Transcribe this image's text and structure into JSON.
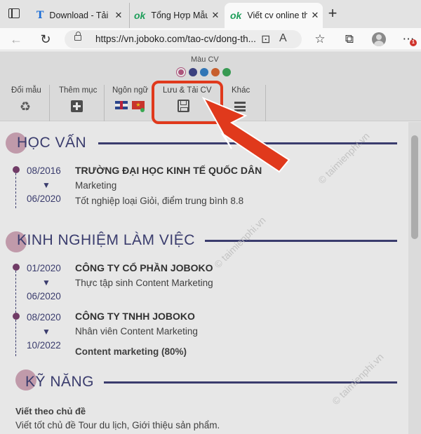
{
  "browser": {
    "tabs": [
      {
        "favicon": "T",
        "title": "Download - Tải",
        "close": "✕"
      },
      {
        "favicon": "ok",
        "title": "Tổng Hợp Mẫu",
        "close": "✕"
      },
      {
        "favicon": "ok",
        "title": "Viết cv online th",
        "close": "✕"
      }
    ],
    "url": "https://vn.joboko.com/tao-cv/dong-th...",
    "notification_count": "1",
    "icons": [
      "tab-actions-icon",
      "back-icon",
      "refresh-icon",
      "lock-icon",
      "page-icon",
      "read-aloud-icon",
      "favorites-icon",
      "collections-icon",
      "profile-icon",
      "menu-dots-icon"
    ]
  },
  "toolbar": {
    "color_label": "Màu CV",
    "colors": [
      "#b84d7d",
      "#2e3580",
      "#2176c4",
      "#d85a1e",
      "#2aa14b"
    ],
    "tools": [
      {
        "label": "Đổi mẫu",
        "icon": "recycle-icon"
      },
      {
        "label": "Thêm mục",
        "icon": "plus-square-icon"
      },
      {
        "label": "Ngôn ngữ",
        "icon": "flag-icon"
      },
      {
        "label": "Lưu & Tải CV",
        "icon": "save-icon"
      },
      {
        "label": "Khác",
        "icon": "menu-icon"
      }
    ]
  },
  "education": {
    "title": "HỌC VẤN",
    "entries": [
      {
        "start": "08/2016",
        "end": "06/2020",
        "school": "TRƯỜNG ĐẠI HỌC KINH TẾ QUỐC DÂN",
        "major": "Marketing",
        "note": "Tốt nghiệp loại Giỏi, điểm trung bình 8.8"
      }
    ]
  },
  "experience": {
    "title": "KINH NGHIỆM LÀM VIỆC",
    "entries": [
      {
        "start": "01/2020",
        "end": "06/2020",
        "company": "CÔNG TY CỔ PHẦN JOBOKO",
        "role": "Thực tập sinh Content Marketing"
      },
      {
        "start": "08/2020",
        "end": "10/2022",
        "company": "CÔNG TY TNHH JOBOKO",
        "role": "Nhân viên Content Marketing",
        "extra": "Content marketing (80%)"
      }
    ]
  },
  "skills": {
    "title": "KỸ NĂNG",
    "items": [
      {
        "name": "Viết theo chủ đề",
        "desc": "Viết tốt chủ đề Tour du lịch, Giới thiệu sản phẩm."
      }
    ]
  },
  "watermark": "© taimienphi.vn",
  "annotation_color": "#e0391c"
}
